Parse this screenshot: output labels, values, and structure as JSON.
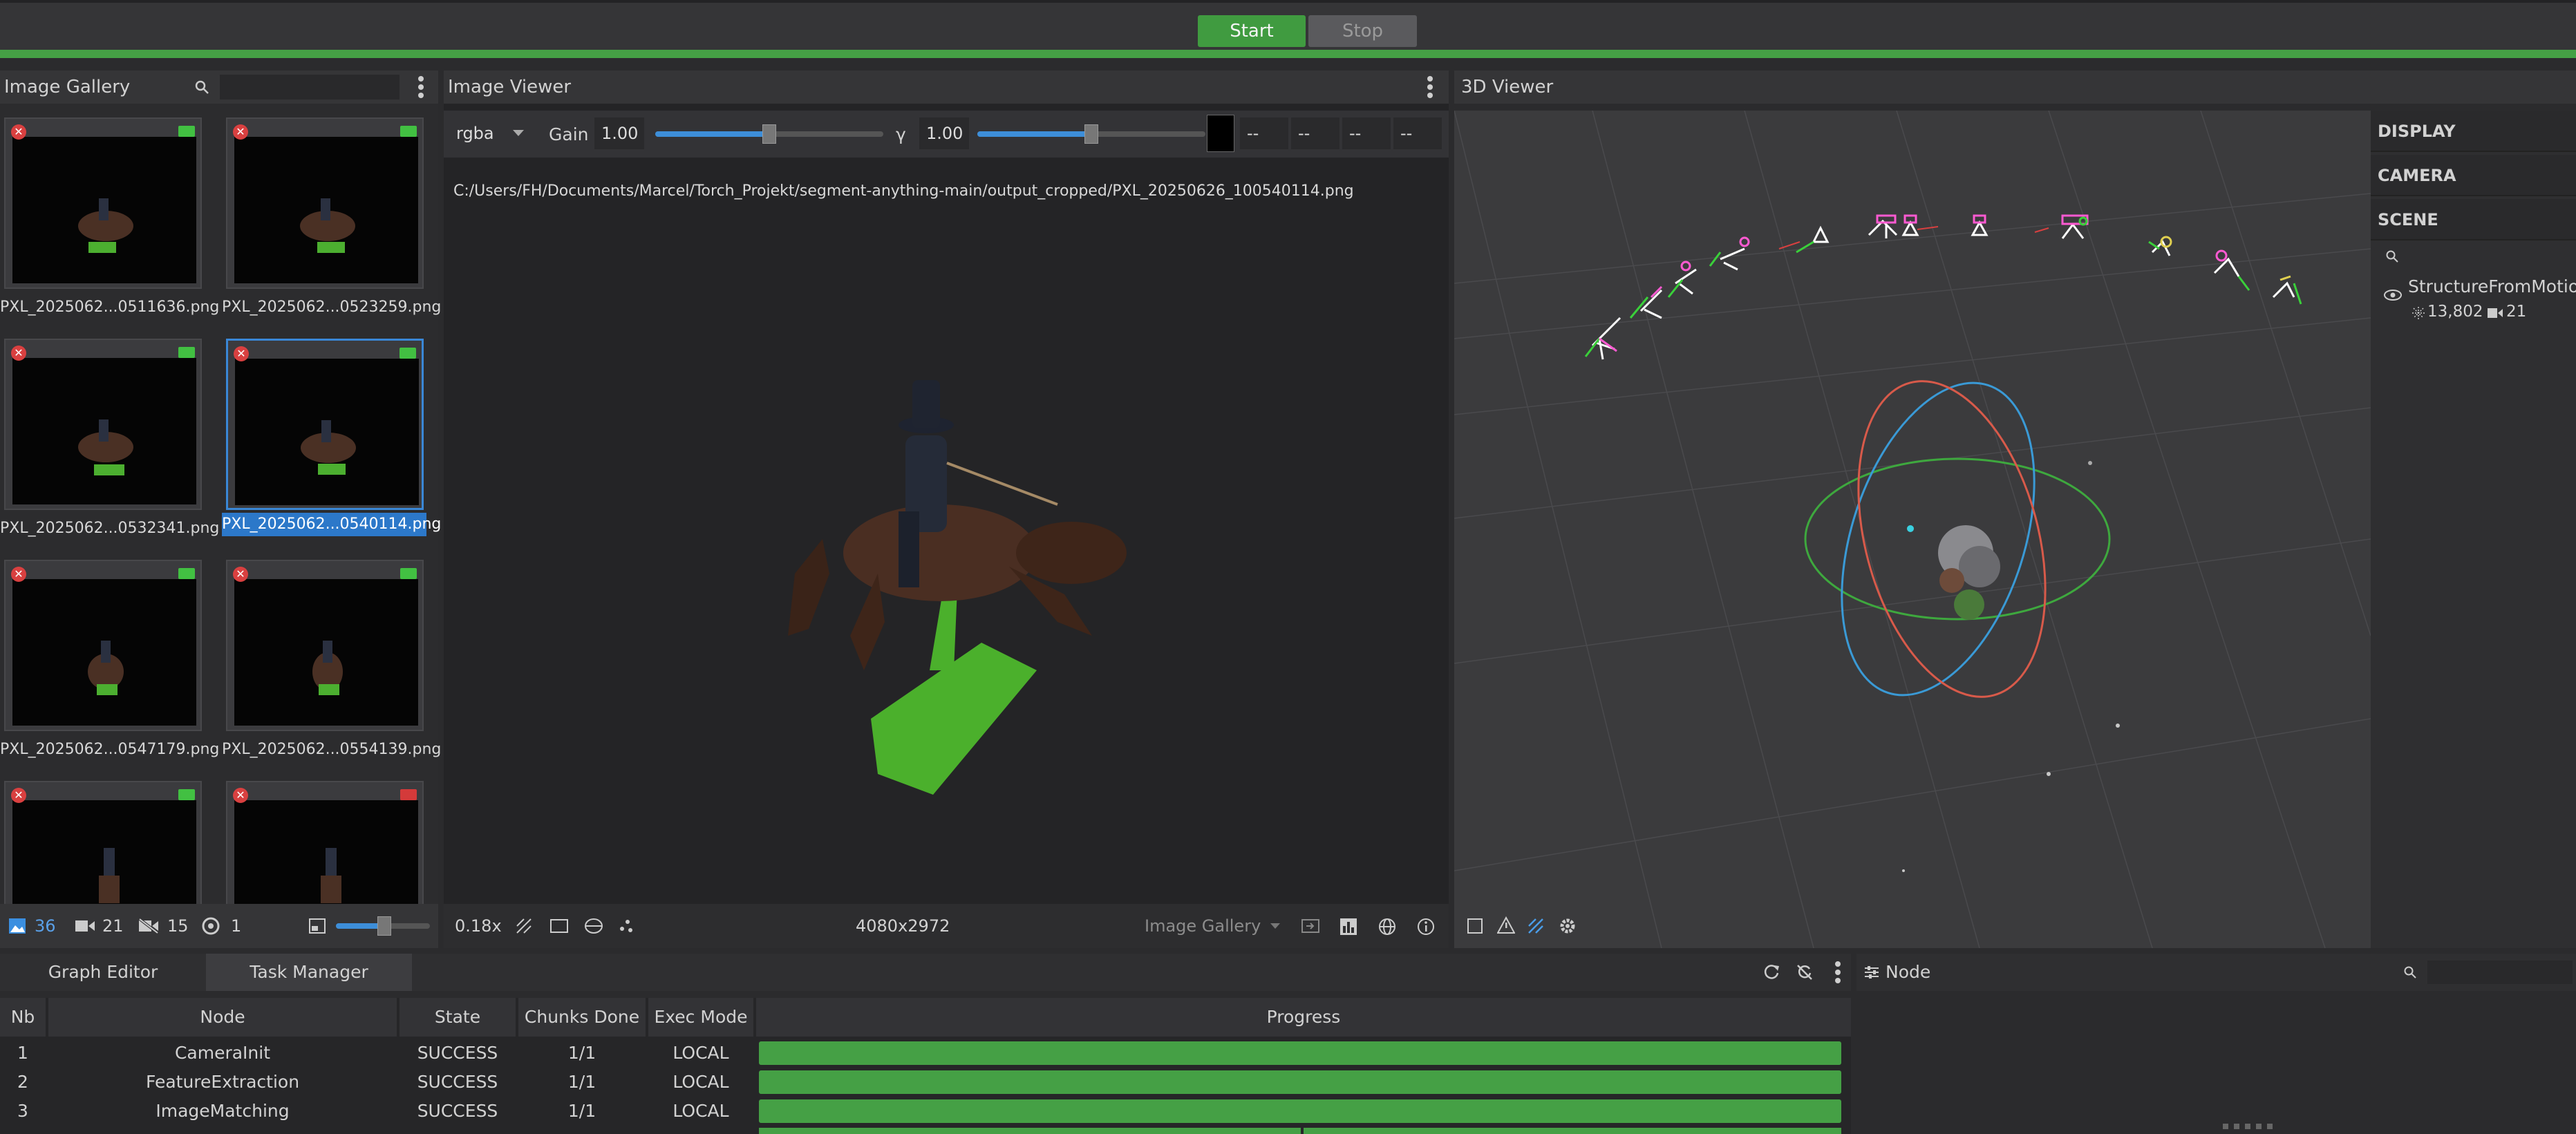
{
  "topbar": {
    "start_label": "Start",
    "stop_label": "Stop",
    "progress_color": "#45a045"
  },
  "gallery": {
    "title": "Image Gallery",
    "search_placeholder": "",
    "items": [
      {
        "label": "PXL_2025062...0511636.png",
        "selected": false,
        "status": "camera"
      },
      {
        "label": "PXL_2025062...0523259.png",
        "selected": false,
        "status": "camera"
      },
      {
        "label": "PXL_2025062...0532341.png",
        "selected": false,
        "status": "camera"
      },
      {
        "label": "PXL_2025062...0540114.png",
        "selected": true,
        "status": "camera"
      },
      {
        "label": "PXL_2025062...0547179.png",
        "selected": false,
        "status": "camera"
      },
      {
        "label": "PXL_2025062...0554139.png",
        "selected": false,
        "status": "camera"
      },
      {
        "label": "",
        "selected": false,
        "status": "camera"
      },
      {
        "label": "",
        "selected": false,
        "status": "camera-off"
      }
    ],
    "footer": {
      "images": "36",
      "cameras": "21",
      "no_cameras": "15",
      "rigs": "1"
    }
  },
  "image_viewer": {
    "title": "Image Viewer",
    "channel": "rgba",
    "gain_label": "Gain",
    "gain_value": "1.00",
    "gain_level": 0.5,
    "gamma_label": "γ",
    "gamma_value": "1.00",
    "gamma_level": 0.5,
    "pixel_values": [
      "--",
      "--",
      "--",
      "--"
    ],
    "path": "C:/Users/FH/Documents/Marcel/Torch_Projekt/segment-anything-main/output_cropped/PXL_20250626_100540114.png",
    "zoom": "0.18x",
    "resolution": "4080x2972",
    "source": "Image Gallery"
  },
  "viewer3d": {
    "title": "3D Viewer",
    "sections": [
      "DISPLAY",
      "CAMERA",
      "SCENE"
    ],
    "scene_search_placeholder": "",
    "scene_item": {
      "name": "StructureFromMotion",
      "points": "13,802",
      "cameras": "21"
    }
  },
  "tasks": {
    "tabs": [
      "Graph Editor",
      "Task Manager"
    ],
    "active_tab": 1,
    "columns": [
      "Nb",
      "Node",
      "State",
      "Chunks Done",
      "Exec Mode",
      "Progress"
    ],
    "rows": [
      {
        "nb": "1",
        "node": "CameraInit",
        "state": "SUCCESS",
        "chunks": "1/1",
        "mode": "LOCAL",
        "progress": 1.0
      },
      {
        "nb": "2",
        "node": "FeatureExtraction",
        "state": "SUCCESS",
        "chunks": "1/1",
        "mode": "LOCAL",
        "progress": 1.0
      },
      {
        "nb": "3",
        "node": "ImageMatching",
        "state": "SUCCESS",
        "chunks": "1/1",
        "mode": "LOCAL",
        "progress": 1.0
      }
    ]
  },
  "node_panel": {
    "title": "Node",
    "search_placeholder": ""
  }
}
